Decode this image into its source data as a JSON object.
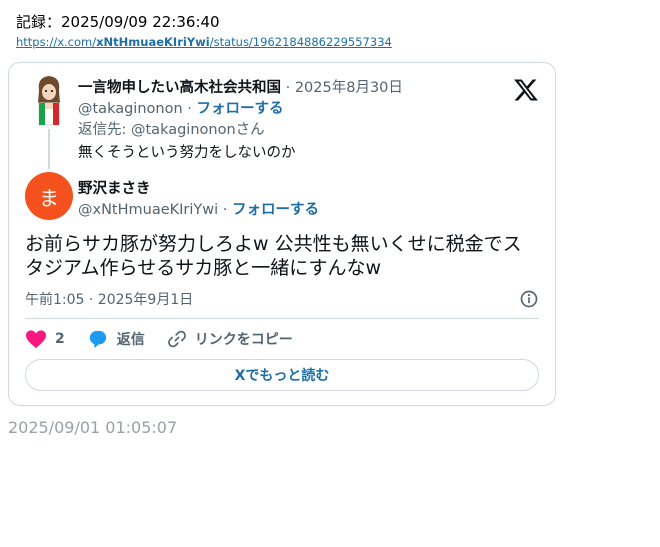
{
  "record": {
    "label": "記録：2025/09/09 22:36:40"
  },
  "source": {
    "prefix": "https://x.com/",
    "handle": "xNtHmuaeKIriYwi",
    "suffix": "/status/1962184886229557334"
  },
  "parent_tweet": {
    "name": "一言物申したい高木社会共和国",
    "date": "2025年8月30日",
    "username": "@takaginonon",
    "follow": "フォローする",
    "reply_to": "返信先: @takaginononさん",
    "text": "無くそうという努力をしないのか"
  },
  "tweet": {
    "avatar_char": "ま",
    "name": "野沢まさき",
    "username": "@xNtHmuaeKIriYwi",
    "follow": "フォローする",
    "text": "お前らサカ豚が努力しろよw 公共性も無いくせに税金でスタジアム作らせるサカ豚と一緒にすんなw",
    "time": "午前1:05 · 2025年9月1日",
    "likes": "2",
    "reply_label": "返信",
    "copy_label": "リンクをコピー",
    "read_more": "Xでもっと読む"
  },
  "footer": {
    "timestamp": "2025/09/01 01:05:07"
  },
  "colors": {
    "accent": "#1d6fa5",
    "like": "#f91880",
    "reply": "#1d9bf0",
    "avatar": "#f4511e"
  },
  "icons": [
    "x-logo-icon",
    "info-icon",
    "heart-icon",
    "reply-bubble-icon",
    "link-icon"
  ]
}
